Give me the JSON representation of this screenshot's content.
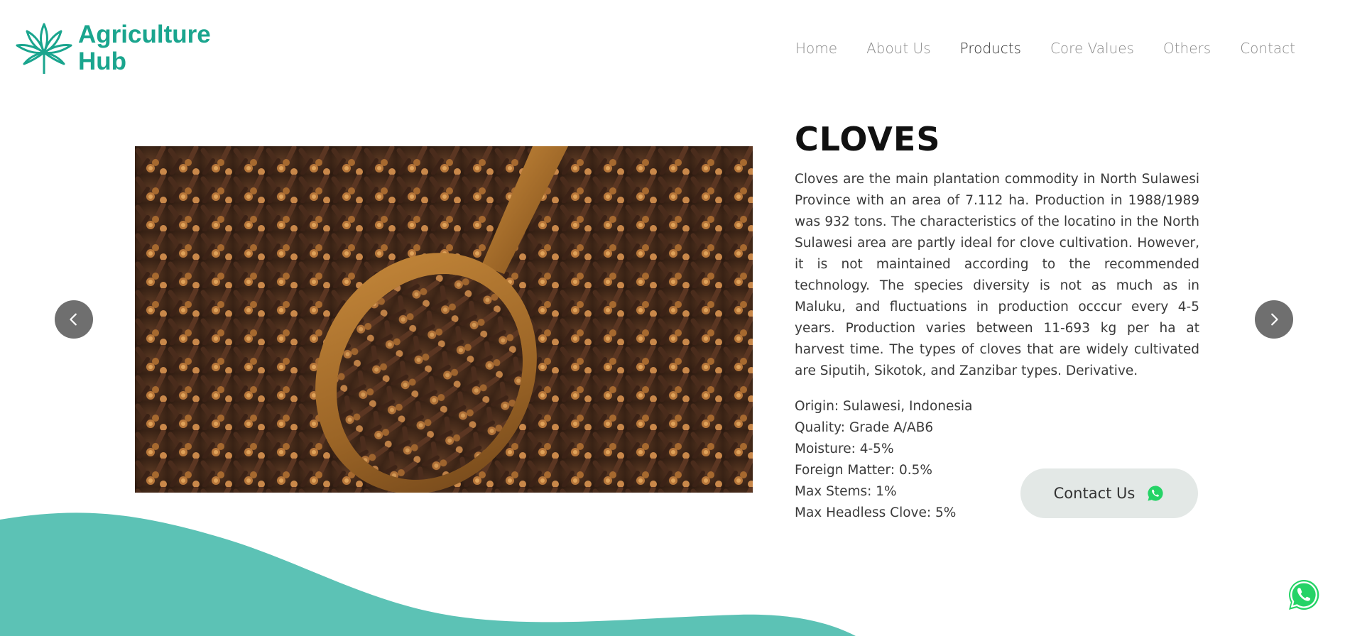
{
  "header": {
    "logo": {
      "line1": "Agriculture",
      "line2": "Hub",
      "icon": "cannabis-leaf-icon"
    },
    "nav": [
      {
        "label": "Home"
      },
      {
        "label": "About Us"
      },
      {
        "label": "Products",
        "active": true
      },
      {
        "label": "Core Values"
      },
      {
        "label": "Others"
      },
      {
        "label": "Contact"
      }
    ]
  },
  "product": {
    "title": "CLOVES",
    "description": "Cloves are the main plantation commodity in North Sulawesi Province with an area of 7.112 ha. Production in 1988/1989 was 932 tons. The characteristics of the locatino in the North Sulawesi area are partly ideal for clove cultivation. However, it is not maintained according to the recommended technology. The species diversity is not as much as in Maluku, and fluctuations in production occcur every 4-5 years. Production varies between 11-693 kg per ha at harvest time. The types of cloves that are widely cultivated are Siputih, Sikotok, and Zanzibar types. Derivative.",
    "specs": [
      "Origin: Sulawesi, Indonesia",
      "Quality: Grade A/AB6",
      "Moisture: 4-5%",
      "Foreign Matter: 0.5%",
      "Max Stems: 1%",
      "Max Headless Clove: 5%"
    ],
    "image_alt": "cloves in wooden spoon"
  },
  "carousel": {
    "prev_icon": "chevron-left-icon",
    "next_icon": "chevron-right-icon"
  },
  "contact_button": {
    "label": "Contact Us",
    "icon": "whatsapp-icon"
  },
  "colors": {
    "brand": "#1aa58e",
    "wave": "#5cc2b5",
    "arrow_bg": "#6f6f6f",
    "button_bg": "#e3e8e6",
    "whatsapp": "#25d366"
  }
}
